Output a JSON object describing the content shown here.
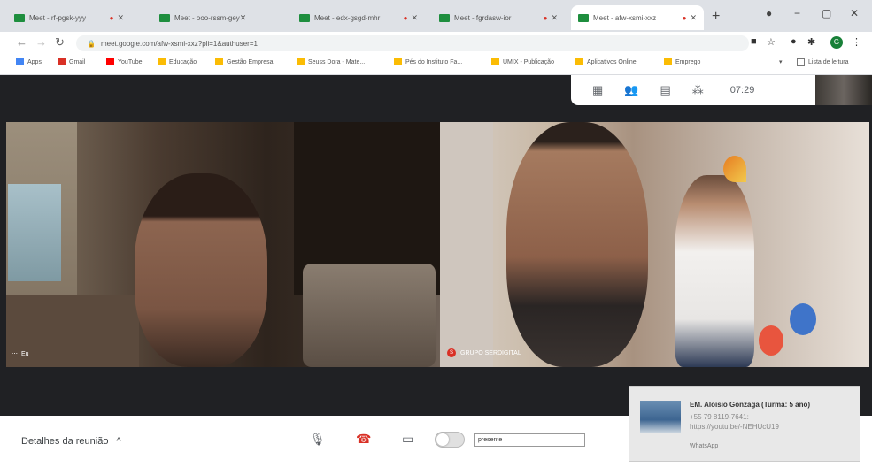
{
  "browser": {
    "tabs": [
      {
        "label": "Meet - rf-pgsk-yyy",
        "active": false
      },
      {
        "label": "Meet - ooo-rssm-gey",
        "active": false
      },
      {
        "label": "Meet - edx-gsgd-mhr",
        "active": false
      },
      {
        "label": "Meet - fgrdasw-ior",
        "active": false
      },
      {
        "label": "Meet - afw-xsmi-xxz",
        "active": true
      }
    ],
    "new_tab": "+",
    "url": "meet.google.com/afw-xsmi-xxz?pli=1&authuser=1",
    "bookmarks": [
      {
        "label": "Apps",
        "color": "#4285f4"
      },
      {
        "label": "Gmail",
        "color": "#d93025"
      },
      {
        "label": "YouTube",
        "color": "#ff0000"
      },
      {
        "label": "Educação",
        "color": "#fbbc04"
      },
      {
        "label": "Gestão Empresa",
        "color": "#fbbc04"
      },
      {
        "label": "Seuss Dora - Mate...",
        "color": "#fbbc04"
      },
      {
        "label": "Pés do Instituto Fa...",
        "color": "#fbbc04"
      },
      {
        "label": "UMIX - Publicação",
        "color": "#fbbc04"
      },
      {
        "label": "Aplicativos Online",
        "color": "#fbbc04"
      },
      {
        "label": "Emprego",
        "color": "#fbbc04"
      }
    ],
    "reading_list": "Lista de leitura",
    "profile_initial": "G"
  },
  "meet": {
    "clock": "07:29",
    "participants": [
      {
        "name": "Eu"
      },
      {
        "name": "GRUPO SERDIGITAL",
        "initial": "S"
      }
    ],
    "details_label": "Detalhes da reunião",
    "presence_text": "presente"
  },
  "notification": {
    "title": "EM. Aloísio Gonzaga (Turma: 5 ano)",
    "body": "+55 79 8119-7641: https://youtu.be/-NEHUcU19",
    "source": "WhatsApp"
  },
  "colors": {
    "meet_bg": "#202124",
    "hangup_red": "#d93025",
    "accent_green": "#188038"
  }
}
